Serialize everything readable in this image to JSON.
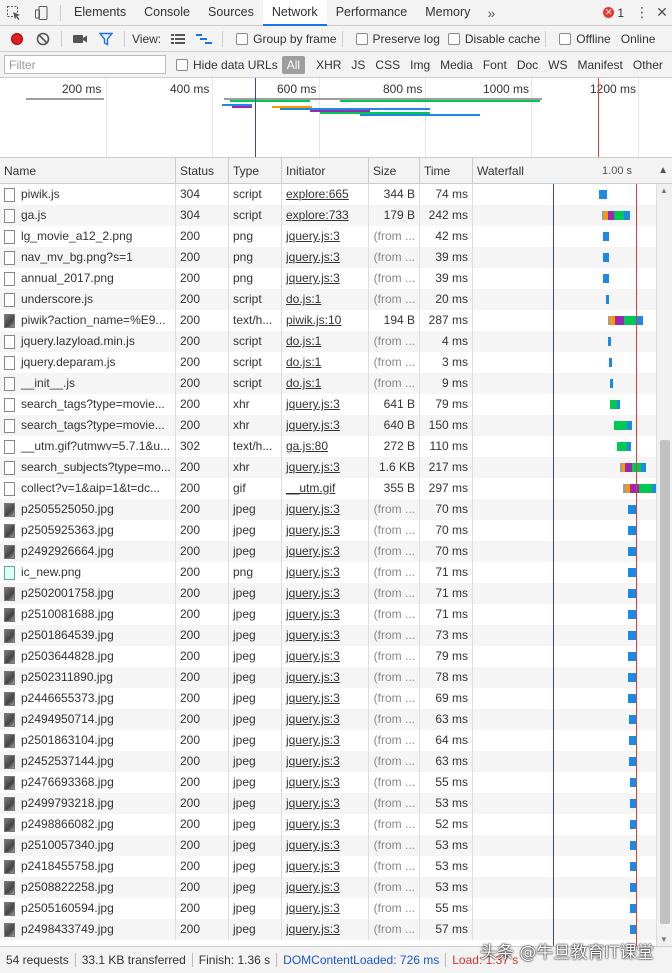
{
  "tabs": {
    "items": [
      "Elements",
      "Console",
      "Sources",
      "Network",
      "Performance",
      "Memory"
    ],
    "more": "»",
    "error_count": "1"
  },
  "toolbar": {
    "view_label": "View:",
    "group_by_frame": "Group by frame",
    "preserve_log": "Preserve log",
    "disable_cache": "Disable cache",
    "offline": "Offline",
    "throttling": "Online"
  },
  "filter": {
    "placeholder": "Filter",
    "hide_data_urls": "Hide data URLs",
    "types": [
      "All",
      "XHR",
      "JS",
      "CSS",
      "Img",
      "Media",
      "Font",
      "Doc",
      "WS",
      "Manifest",
      "Other"
    ]
  },
  "overview": {
    "ticks": [
      "200 ms",
      "400 ms",
      "600 ms",
      "800 ms",
      "1000 ms",
      "1200 ms"
    ]
  },
  "columns": {
    "name": "Name",
    "status": "Status",
    "type": "Type",
    "initiator": "Initiator",
    "size": "Size",
    "time": "Time",
    "waterfall": "Waterfall",
    "waterfall_scale": "1.00 s"
  },
  "requests": [
    {
      "name": "piwik.js",
      "status": "304",
      "type": "script",
      "initiator": "explore:665",
      "size": "344 B",
      "time": "74 ms",
      "icon": "file",
      "wf": [
        0.76,
        0.06
      ]
    },
    {
      "name": "ga.js",
      "status": "304",
      "type": "script",
      "initiator": "explore:733",
      "size": "179 B",
      "time": "242 ms",
      "icon": "file",
      "wf": [
        0.78,
        0.2
      ]
    },
    {
      "name": "lg_movie_a12_2.png",
      "status": "200",
      "type": "png",
      "initiator": "jquery.js:3",
      "size": "(from ...",
      "time": "42 ms",
      "icon": "file",
      "wf": [
        0.79,
        0.04
      ]
    },
    {
      "name": "nav_mv_bg.png?s=1",
      "status": "200",
      "type": "png",
      "initiator": "jquery.js:3",
      "size": "(from ...",
      "time": "39 ms",
      "icon": "file",
      "wf": [
        0.79,
        0.04
      ]
    },
    {
      "name": "annual_2017.png",
      "status": "200",
      "type": "png",
      "initiator": "jquery.js:3",
      "size": "(from ...",
      "time": "39 ms",
      "icon": "file",
      "wf": [
        0.79,
        0.04
      ]
    },
    {
      "name": "underscore.js",
      "status": "200",
      "type": "script",
      "initiator": "do.js:1",
      "size": "(from ...",
      "time": "20 ms",
      "icon": "file",
      "wf": [
        0.81,
        0.02
      ]
    },
    {
      "name": "piwik?action_name=%E9...",
      "status": "200",
      "type": "text/h...",
      "initiator": "piwik.js:10",
      "size": "194 B",
      "time": "287 ms",
      "icon": "img",
      "wf": [
        0.82,
        0.26
      ]
    },
    {
      "name": "jquery.lazyload.min.js",
      "status": "200",
      "type": "script",
      "initiator": "do.js:1",
      "size": "(from ...",
      "time": "4 ms",
      "icon": "file",
      "wf": [
        0.825,
        0.01
      ]
    },
    {
      "name": "jquery.deparam.js",
      "status": "200",
      "type": "script",
      "initiator": "do.js:1",
      "size": "(from ...",
      "time": "3 ms",
      "icon": "file",
      "wf": [
        0.83,
        0.01
      ]
    },
    {
      "name": "__init__.js",
      "status": "200",
      "type": "script",
      "initiator": "do.js:1",
      "size": "(from ...",
      "time": "9 ms",
      "icon": "file",
      "wf": [
        0.835,
        0.01
      ]
    },
    {
      "name": "search_tags?type=movie...",
      "status": "200",
      "type": "xhr",
      "initiator": "jquery.js:3",
      "size": "641 B",
      "time": "79 ms",
      "icon": "file",
      "wf": [
        0.84,
        0.07
      ]
    },
    {
      "name": "search_tags?type=movie...",
      "status": "200",
      "type": "xhr",
      "initiator": "jquery.js:3",
      "size": "640 B",
      "time": "150 ms",
      "icon": "file",
      "wf": [
        0.87,
        0.13
      ]
    },
    {
      "name": "__utm.gif?utmwv=5.7.1&u...",
      "status": "302",
      "type": "text/h...",
      "initiator": "ga.js:80",
      "size": "272 B",
      "time": "110 ms",
      "icon": "file",
      "wf": [
        0.89,
        0.1
      ]
    },
    {
      "name": "search_subjects?type=mo...",
      "status": "200",
      "type": "xhr",
      "initiator": "jquery.js:3",
      "size": "1.6 KB",
      "time": "217 ms",
      "icon": "file",
      "wf": [
        0.91,
        0.19
      ]
    },
    {
      "name": "collect?v=1&aip=1&t=dc...",
      "status": "200",
      "type": "gif",
      "initiator": "__utm.gif",
      "size": "355 B",
      "time": "297 ms",
      "icon": "file",
      "wf": [
        0.93,
        0.27
      ]
    },
    {
      "name": "p2505525050.jpg",
      "status": "200",
      "type": "jpeg",
      "initiator": "jquery.js:3",
      "size": "(from ...",
      "time": "70 ms",
      "icon": "img",
      "wf": [
        0.97,
        0.06
      ]
    },
    {
      "name": "p2505925363.jpg",
      "status": "200",
      "type": "jpeg",
      "initiator": "jquery.js:3",
      "size": "(from ...",
      "time": "70 ms",
      "icon": "img",
      "wf": [
        0.97,
        0.06
      ]
    },
    {
      "name": "p2492926664.jpg",
      "status": "200",
      "type": "jpeg",
      "initiator": "jquery.js:3",
      "size": "(from ...",
      "time": "70 ms",
      "icon": "img",
      "wf": [
        0.97,
        0.06
      ]
    },
    {
      "name": "ic_new.png",
      "status": "200",
      "type": "png",
      "initiator": "jquery.js:3",
      "size": "(from ...",
      "time": "71 ms",
      "icon": "png",
      "wf": [
        0.97,
        0.06
      ]
    },
    {
      "name": "p2502001758.jpg",
      "status": "200",
      "type": "jpeg",
      "initiator": "jquery.js:3",
      "size": "(from ...",
      "time": "71 ms",
      "icon": "img",
      "wf": [
        0.97,
        0.06
      ]
    },
    {
      "name": "p2510081688.jpg",
      "status": "200",
      "type": "jpeg",
      "initiator": "jquery.js:3",
      "size": "(from ...",
      "time": "71 ms",
      "icon": "img",
      "wf": [
        0.97,
        0.06
      ]
    },
    {
      "name": "p2501864539.jpg",
      "status": "200",
      "type": "jpeg",
      "initiator": "jquery.js:3",
      "size": "(from ...",
      "time": "73 ms",
      "icon": "img",
      "wf": [
        0.97,
        0.06
      ]
    },
    {
      "name": "p2503644828.jpg",
      "status": "200",
      "type": "jpeg",
      "initiator": "jquery.js:3",
      "size": "(from ...",
      "time": "79 ms",
      "icon": "img",
      "wf": [
        0.97,
        0.06
      ]
    },
    {
      "name": "p2502311890.jpg",
      "status": "200",
      "type": "jpeg",
      "initiator": "jquery.js:3",
      "size": "(from ...",
      "time": "78 ms",
      "icon": "img",
      "wf": [
        0.97,
        0.06
      ]
    },
    {
      "name": "p2446655373.jpg",
      "status": "200",
      "type": "jpeg",
      "initiator": "jquery.js:3",
      "size": "(from ...",
      "time": "69 ms",
      "icon": "img",
      "wf": [
        0.97,
        0.06
      ]
    },
    {
      "name": "p2494950714.jpg",
      "status": "200",
      "type": "jpeg",
      "initiator": "jquery.js:3",
      "size": "(from ...",
      "time": "63 ms",
      "icon": "img",
      "wf": [
        0.975,
        0.055
      ]
    },
    {
      "name": "p2501863104.jpg",
      "status": "200",
      "type": "jpeg",
      "initiator": "jquery.js:3",
      "size": "(from ...",
      "time": "64 ms",
      "icon": "img",
      "wf": [
        0.975,
        0.055
      ]
    },
    {
      "name": "p2452537144.jpg",
      "status": "200",
      "type": "jpeg",
      "initiator": "jquery.js:3",
      "size": "(from ...",
      "time": "63 ms",
      "icon": "img",
      "wf": [
        0.975,
        0.055
      ]
    },
    {
      "name": "p2476693368.jpg",
      "status": "200",
      "type": "jpeg",
      "initiator": "jquery.js:3",
      "size": "(from ...",
      "time": "55 ms",
      "icon": "img",
      "wf": [
        0.98,
        0.05
      ]
    },
    {
      "name": "p2499793218.jpg",
      "status": "200",
      "type": "jpeg",
      "initiator": "jquery.js:3",
      "size": "(from ...",
      "time": "53 ms",
      "icon": "img",
      "wf": [
        0.98,
        0.05
      ]
    },
    {
      "name": "p2498866082.jpg",
      "status": "200",
      "type": "jpeg",
      "initiator": "jquery.js:3",
      "size": "(from ...",
      "time": "52 ms",
      "icon": "img",
      "wf": [
        0.98,
        0.05
      ]
    },
    {
      "name": "p2510057340.jpg",
      "status": "200",
      "type": "jpeg",
      "initiator": "jquery.js:3",
      "size": "(from ...",
      "time": "53 ms",
      "icon": "img",
      "wf": [
        0.98,
        0.05
      ]
    },
    {
      "name": "p2418455758.jpg",
      "status": "200",
      "type": "jpeg",
      "initiator": "jquery.js:3",
      "size": "(from ...",
      "time": "53 ms",
      "icon": "img",
      "wf": [
        0.98,
        0.05
      ]
    },
    {
      "name": "p2508822258.jpg",
      "status": "200",
      "type": "jpeg",
      "initiator": "jquery.js:3",
      "size": "(from ...",
      "time": "53 ms",
      "icon": "img",
      "wf": [
        0.98,
        0.05
      ]
    },
    {
      "name": "p2505160594.jpg",
      "status": "200",
      "type": "jpeg",
      "initiator": "jquery.js:3",
      "size": "(from ...",
      "time": "55 ms",
      "icon": "img",
      "wf": [
        0.985,
        0.05
      ]
    },
    {
      "name": "p2498433749.jpg",
      "status": "200",
      "type": "jpeg",
      "initiator": "jquery.js:3",
      "size": "(from ...",
      "time": "57 ms",
      "icon": "img",
      "wf": [
        0.985,
        0.05
      ]
    }
  ],
  "status_bar": {
    "requests": "54 requests",
    "transferred": "33.1 KB transferred",
    "finish": "Finish: 1.36 s",
    "dom_content_loaded": "DOMContentLoaded: 726 ms",
    "load": "Load: 1.37 s"
  },
  "watermark": "头条 @牛旦教育IT课堂",
  "colors": {
    "accent": "#1a73e8",
    "wait": "#00c853",
    "download": "#1e88e5",
    "stalled": "#9e9e9e",
    "ssl": "#9c27b0",
    "dns": "#ff9800",
    "dcl_line": "#3949ab",
    "load_line": "#e53935"
  }
}
